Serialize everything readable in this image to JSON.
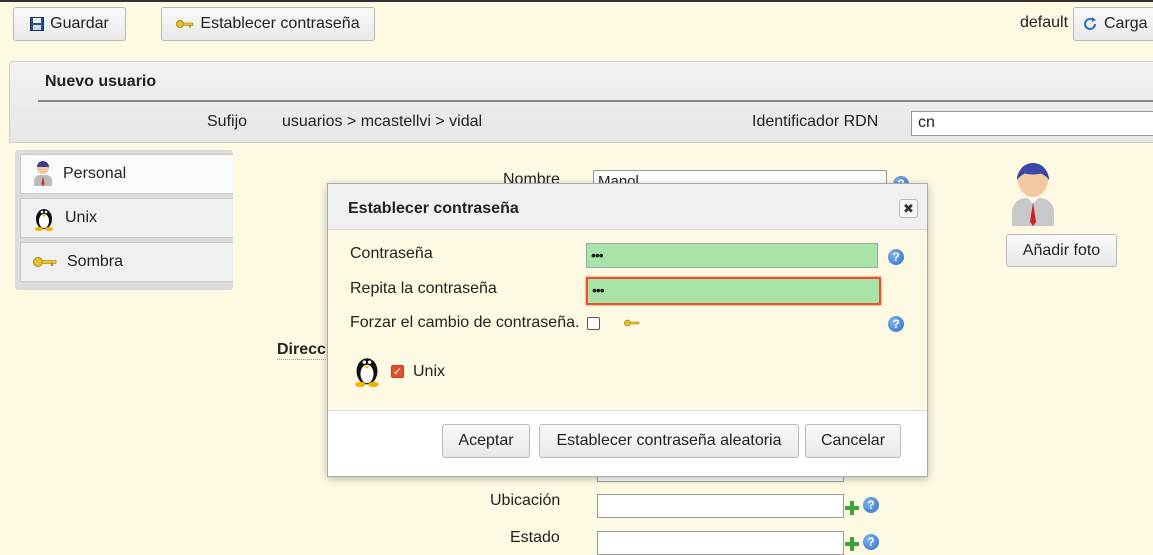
{
  "toolbar": {
    "save_label": "Guardar",
    "set_password_label": "Establecer contraseña",
    "profile_label": "default",
    "load_label": "Carga"
  },
  "header": {
    "title": "Nuevo usuario",
    "suffix_label": "Sufijo",
    "suffix_value": "usuarios > mcastellvi > vidal",
    "rdn_label": "Identificador RDN",
    "rdn_value": "cn"
  },
  "sidebar": {
    "items": [
      {
        "label": "Personal",
        "icon": "user-icon"
      },
      {
        "label": "Unix",
        "icon": "penguin-icon"
      },
      {
        "label": "Sombra",
        "icon": "key-icon"
      }
    ]
  },
  "form": {
    "name_label": "Nombre",
    "name_value": "Manol",
    "address_label": "Direcc",
    "location_label": "Ubicación",
    "status_label": "Estado",
    "add_photo_label": "Añadir foto"
  },
  "dialog": {
    "title": "Establecer contraseña",
    "password_label": "Contraseña",
    "password_value": "•••",
    "repeat_label": "Repita la contraseña",
    "repeat_value": "•••",
    "force_change_label": "Forzar el cambio de contraseña.",
    "unix_label": "Unix",
    "unix_checked": true,
    "accept_label": "Aceptar",
    "random_label": "Establecer contraseña aleatoria",
    "cancel_label": "Cancelar"
  },
  "colors": {
    "page_bg": "#fdf9e3",
    "password_bg": "#a8e3a8",
    "focus_border": "#e05530",
    "help_icon": "#2f6fc6",
    "plus_icon": "#3aa53a"
  }
}
